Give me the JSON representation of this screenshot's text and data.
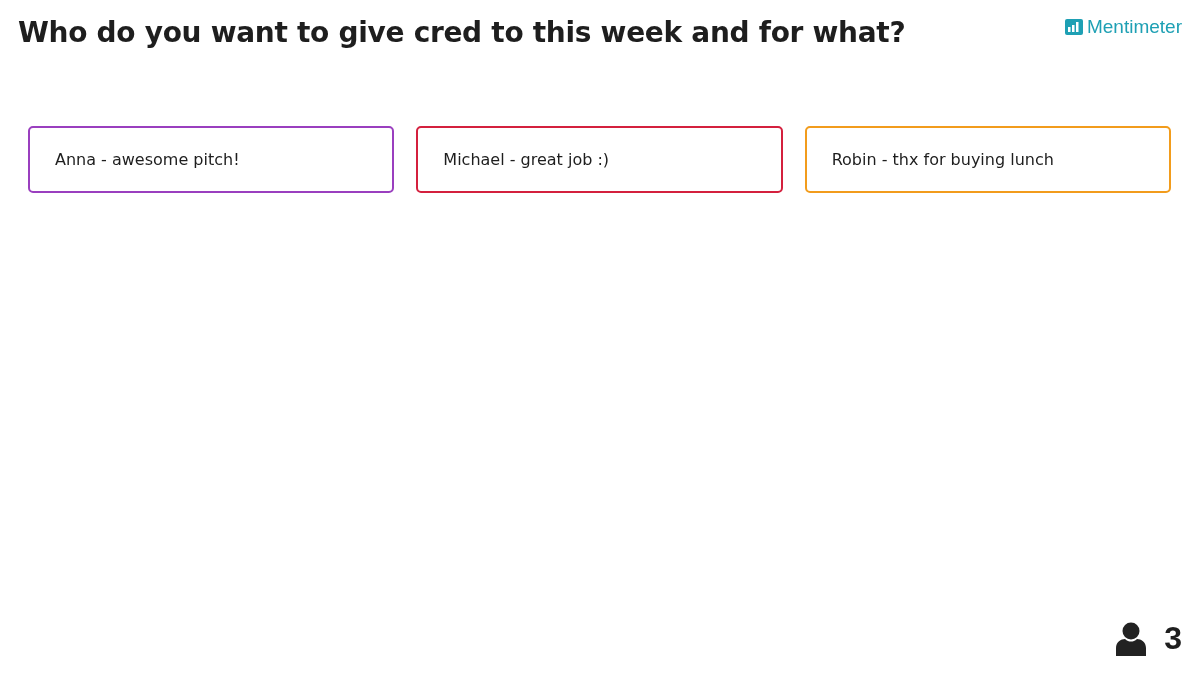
{
  "title": "Who do you want to give cred to this week and for what?",
  "logo": {
    "text": "Mentimeter"
  },
  "responses": [
    {
      "text": "Anna - awesome pitch!",
      "color": "#9a3fbf"
    },
    {
      "text": "Michael - great job :)",
      "color": "#d4203e"
    },
    {
      "text": "Robin - thx for buying lunch",
      "color": "#f29c1c"
    }
  ],
  "participants": "3"
}
